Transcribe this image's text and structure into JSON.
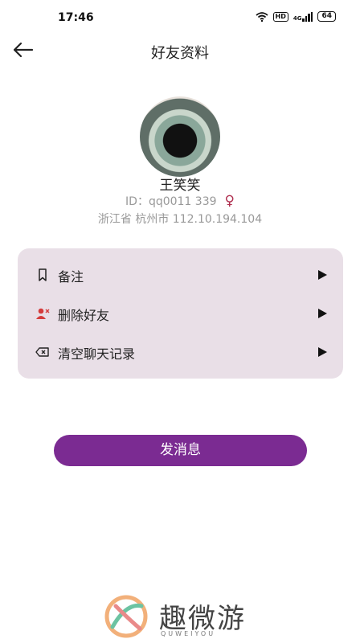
{
  "status_bar": {
    "time": "17:46",
    "hd": "HD",
    "signal_label": "4G",
    "battery": "64"
  },
  "header": {
    "title": "好友资料",
    "back_icon": "arrow-left-icon"
  },
  "profile": {
    "name": "王笑笑",
    "id_text": "ID：qq0011 339",
    "gender_symbol": "♀",
    "location": "浙江省 杭州市 112.10.194.104"
  },
  "menu": {
    "items": [
      {
        "label": "备注",
        "icon": "bookmark-icon"
      },
      {
        "label": "删除好友",
        "icon": "remove-user-icon"
      },
      {
        "label": "清空聊天记录",
        "icon": "clear-icon"
      }
    ]
  },
  "actions": {
    "send_message": "发消息"
  },
  "footer": {
    "brand_cn": "趣微游",
    "brand_en": "QUWEIYOU"
  },
  "colors": {
    "primary": "#7b2b92",
    "card_bg": "#e9dfe7",
    "female": "#b03050"
  }
}
